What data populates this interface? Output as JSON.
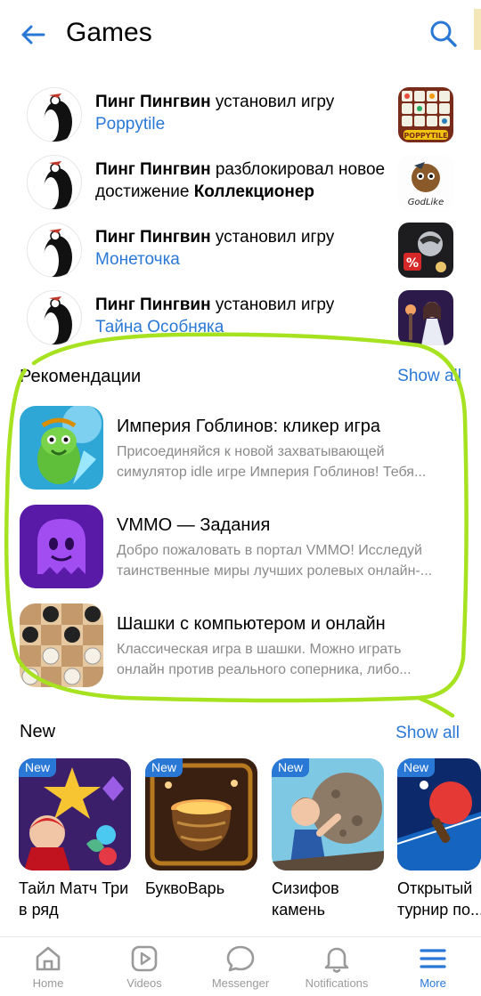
{
  "header": {
    "title": "Games"
  },
  "feed": [
    {
      "user": "Пинг Пингвин",
      "action": "установил игру",
      "game": "Poppytile"
    },
    {
      "user": "Пинг Пингвин",
      "action": "разблокировал новое достижение",
      "achievement": "Коллекционер"
    },
    {
      "user": "Пинг Пингвин",
      "action": "установил игру",
      "game": "Монеточка"
    },
    {
      "user": "Пинг Пингвин",
      "action": "установил игру",
      "game": "Тайна Особняка"
    }
  ],
  "recommendations": {
    "title": "Рекомендации",
    "show_all": "Show all",
    "items": [
      {
        "name": "Империя Гоблинов: кликер игра",
        "desc_line1": "Присоединяйся к новой захватывающей",
        "desc_line2": "симулятор idle игре Империя Гоблинов! Тебя..."
      },
      {
        "name": "VMMO — Задания",
        "desc_line1": "Добро пожаловать в портал VMMO! Исследуй",
        "desc_line2": "таинственные миры лучших ролевых онлайн-..."
      },
      {
        "name": "Шашки с компьютером и онлайн",
        "desc_line1": "Классическая игра в шашки. Можно играть",
        "desc_line2": "онлайн против реального соперника, либо..."
      }
    ]
  },
  "new_section": {
    "title": "New",
    "show_all": "Show all",
    "badge": "New",
    "items": [
      {
        "line1": "Тайл Матч Три",
        "line2": "в ряд"
      },
      {
        "line1": "БуквоВарь",
        "line2": ""
      },
      {
        "line1": "Сизифов",
        "line2": "камень"
      },
      {
        "line1": "Открытый",
        "line2": "турнир по..."
      }
    ]
  },
  "bottom_nav": [
    {
      "label": "Home",
      "icon": "home-icon"
    },
    {
      "label": "Videos",
      "icon": "video-icon"
    },
    {
      "label": "Messenger",
      "icon": "chat-bubble-icon"
    },
    {
      "label": "Notifications",
      "icon": "bell-icon"
    },
    {
      "label": "More",
      "icon": "menu-icon",
      "active": true
    }
  ],
  "colors": {
    "accent": "#2a78d6",
    "highlight": "#a6e21f",
    "muted": "#8a8a8a"
  }
}
